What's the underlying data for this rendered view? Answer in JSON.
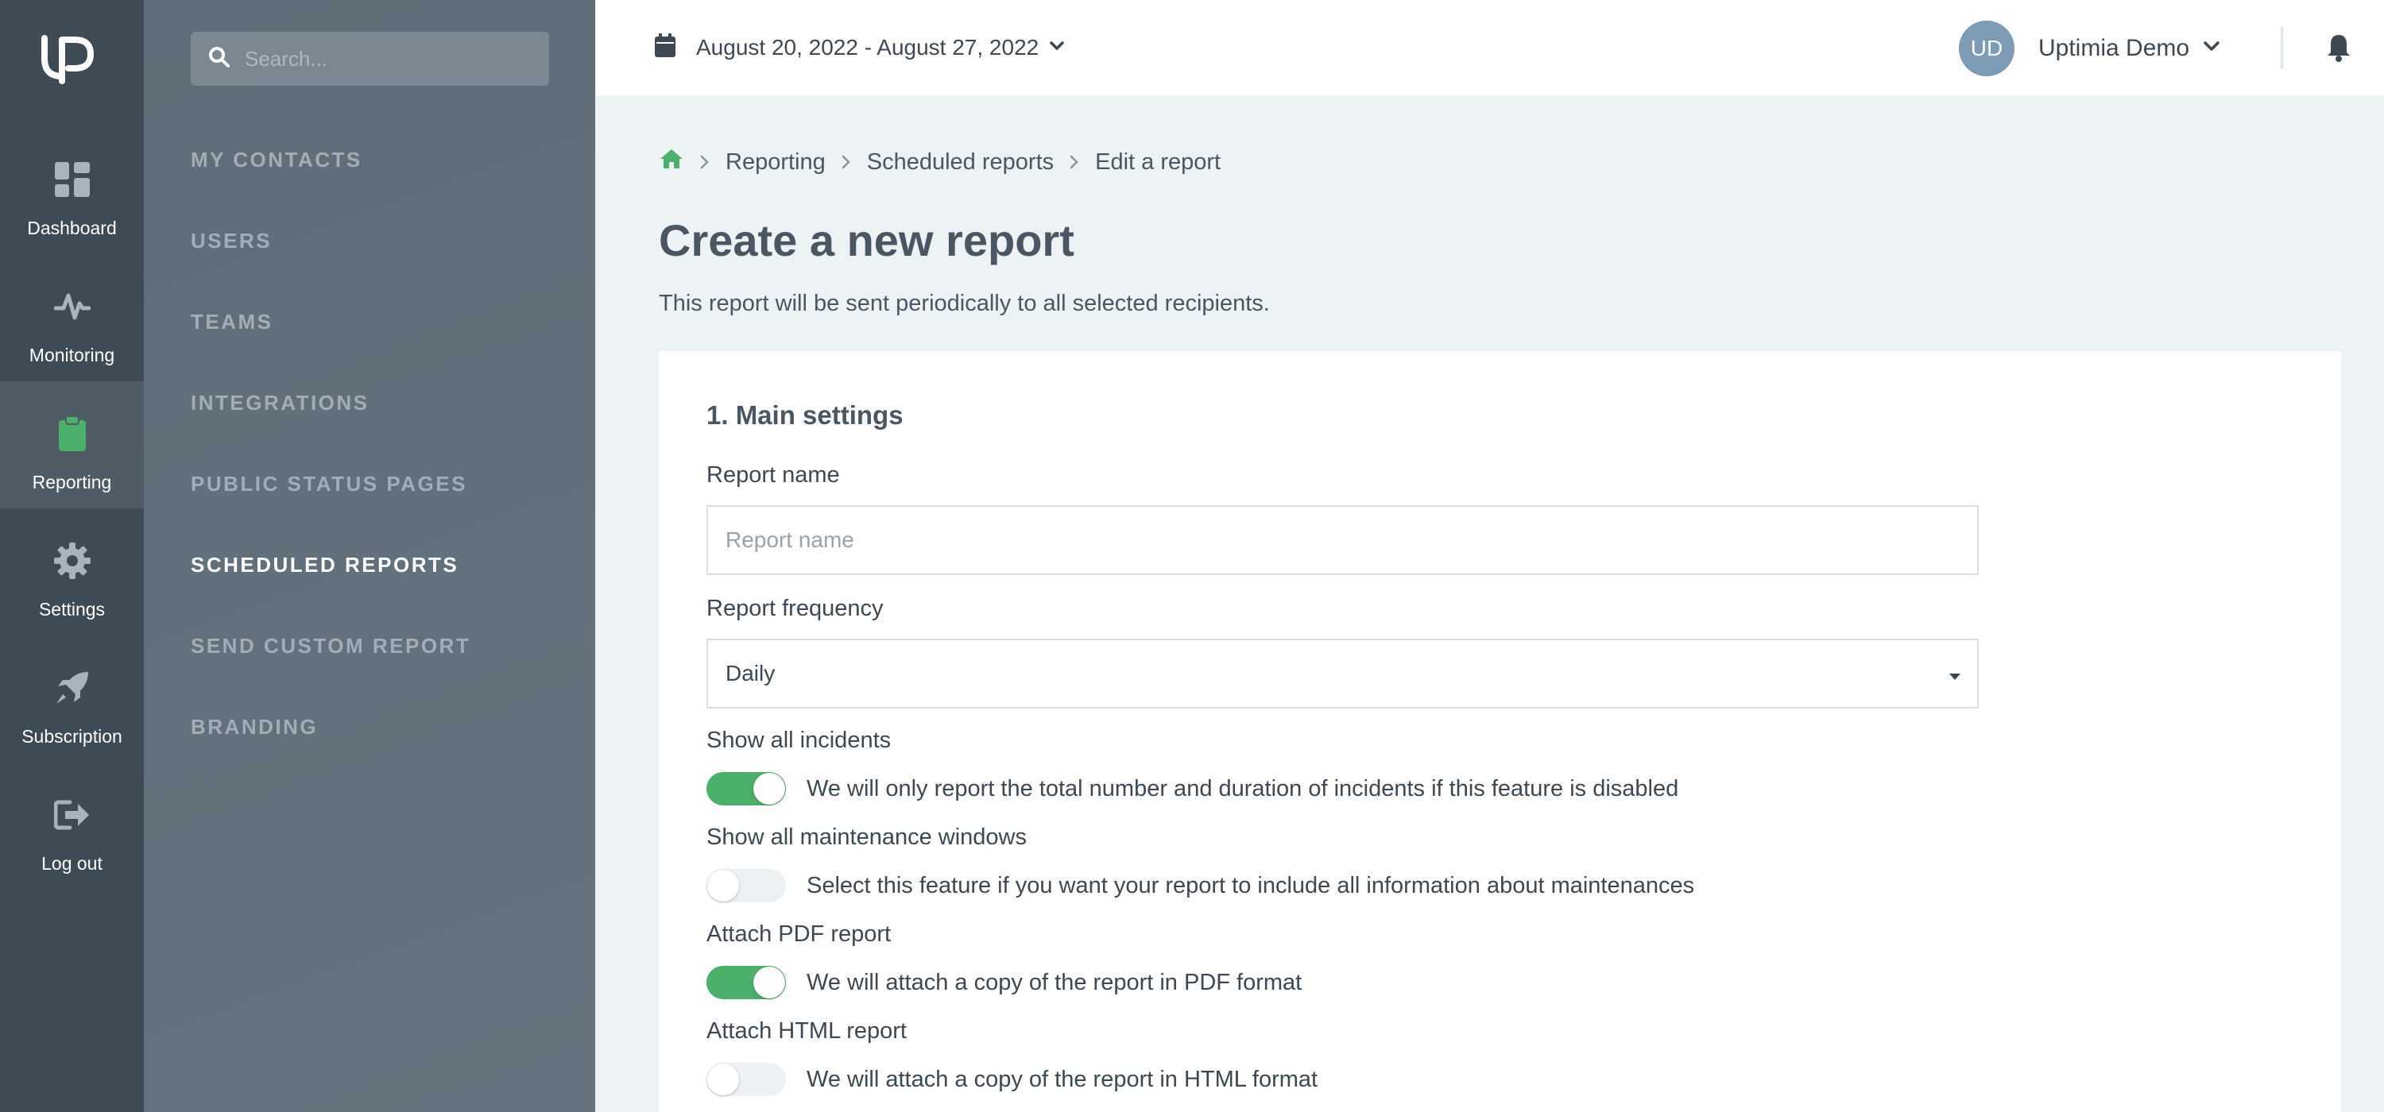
{
  "rail": {
    "items": [
      {
        "label": "Dashboard",
        "icon": "dashboard-icon"
      },
      {
        "label": "Monitoring",
        "icon": "pulse-icon"
      },
      {
        "label": "Reporting",
        "icon": "clipboard-icon",
        "active": true
      },
      {
        "label": "Settings",
        "icon": "gear-icon"
      },
      {
        "label": "Subscription",
        "icon": "rocket-icon"
      },
      {
        "label": "Log out",
        "icon": "logout-icon"
      }
    ]
  },
  "subnav": {
    "search_placeholder": "Search...",
    "items": [
      {
        "label": "MY CONTACTS"
      },
      {
        "label": "USERS"
      },
      {
        "label": "TEAMS"
      },
      {
        "label": "INTEGRATIONS"
      },
      {
        "label": "PUBLIC STATUS PAGES"
      },
      {
        "label": "SCHEDULED REPORTS",
        "active": true
      },
      {
        "label": "SEND CUSTOM REPORT"
      },
      {
        "label": "BRANDING"
      }
    ]
  },
  "header": {
    "date_range": "August 20, 2022 - August 27, 2022",
    "avatar_initials": "UD",
    "user_name": "Uptimia Demo"
  },
  "breadcrumb": {
    "items": [
      "Reporting",
      "Scheduled reports"
    ],
    "current": "Edit a report"
  },
  "page": {
    "title": "Create a new report",
    "subtitle": "This report will be sent periodically to all selected recipients."
  },
  "form": {
    "section_title": "1. Main settings",
    "report_name_label": "Report name",
    "report_name_placeholder": "Report name",
    "report_name_value": "",
    "frequency_label": "Report frequency",
    "frequency_value": "Daily",
    "toggles": [
      {
        "label": "Show all incidents",
        "description": "We will only report the total number and duration of incidents if this feature is disabled",
        "on": true
      },
      {
        "label": "Show all maintenance windows",
        "description": "Select this feature if you want your report to include all information about maintenances",
        "on": false
      },
      {
        "label": "Attach PDF report",
        "description": "We will attach a copy of the report in PDF format",
        "on": true
      },
      {
        "label": "Attach HTML report",
        "description": "We will attach a copy of the report in HTML format",
        "on": false
      }
    ]
  },
  "colors": {
    "accent": "#4caf6a",
    "rail_bg": "#3e4a54",
    "subnav_bg": "#5f6d78",
    "avatar_bg": "#7e9bb5"
  }
}
